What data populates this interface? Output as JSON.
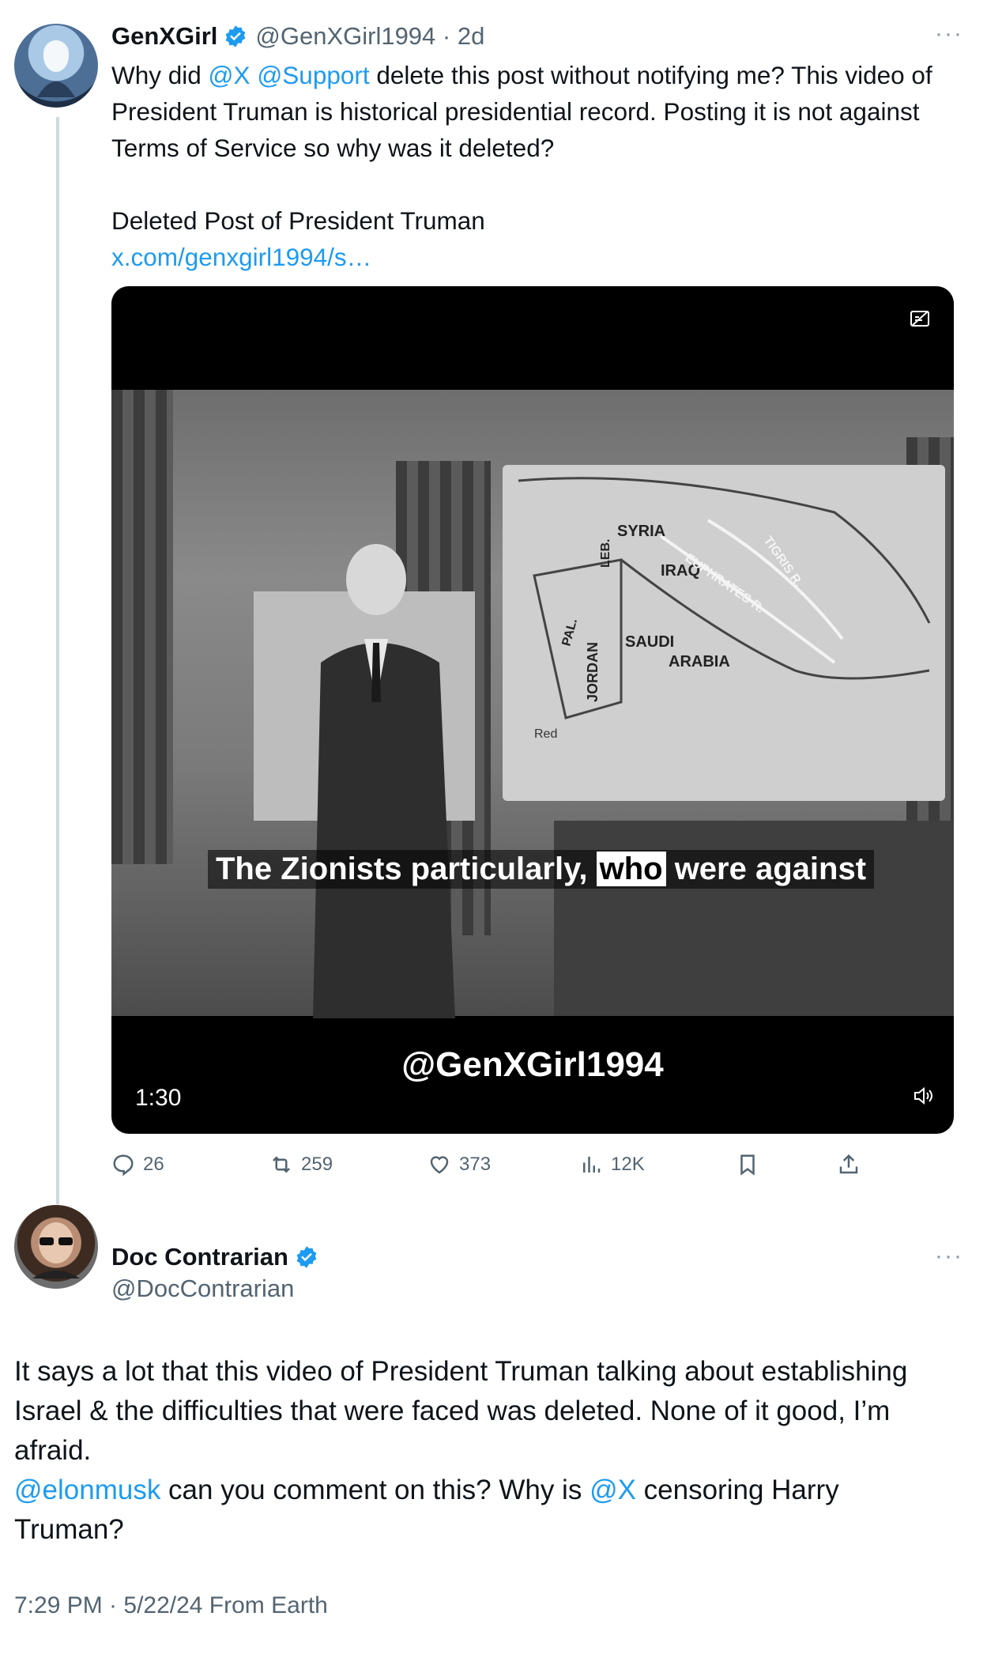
{
  "tweet1": {
    "display_name": "GenXGirl",
    "handle": "@GenXGirl1994",
    "time": "2d",
    "more": "···",
    "text": {
      "line1_prefix": "Why did ",
      "mention_x": "@X",
      "mention_support": "@Support",
      "line1_rest": " delete this post without notifying me? This video of President Truman is historical presidential record. Posting it is not against Terms of Service so why was it deleted?",
      "quote_title": "Deleted Post of President Truman",
      "link": "x.com/genxgirl1994/s…"
    },
    "video": {
      "map_labels": [
        "SYRIA",
        "IRAQ",
        "SAUDI",
        "ARABIA",
        "JORDAN",
        "PAL.",
        "LEB.",
        "TIGRIS R.",
        "EUPHRATES R.",
        "Red"
      ],
      "caption_before": "The Zionists particularly, ",
      "caption_highlight": "who",
      "caption_after": " were against",
      "watermark": "@GenXGirl1994",
      "duration": "1:30"
    },
    "actions": {
      "replies": "26",
      "reposts": "259",
      "likes": "373",
      "views": "12K"
    }
  },
  "tweet2": {
    "display_name": "Doc Contrarian",
    "handle": "@DocContrarian",
    "more": "···",
    "text": {
      "para1": "It says a lot that this video of President Truman talking about establishing Israel & the difficulties that were faced was deleted. None of it good, I’m afraid.",
      "mention_elon": "@elonmusk",
      "mid": " can you comment on this? Why is ",
      "mention_x": "@X",
      "end": " censoring Harry Truman?"
    },
    "footer": "7:29 PM · 5/22/24 From Earth"
  },
  "colors": {
    "accent": "#1d9bf0",
    "muted": "#536471",
    "line": "#cfd9de"
  }
}
